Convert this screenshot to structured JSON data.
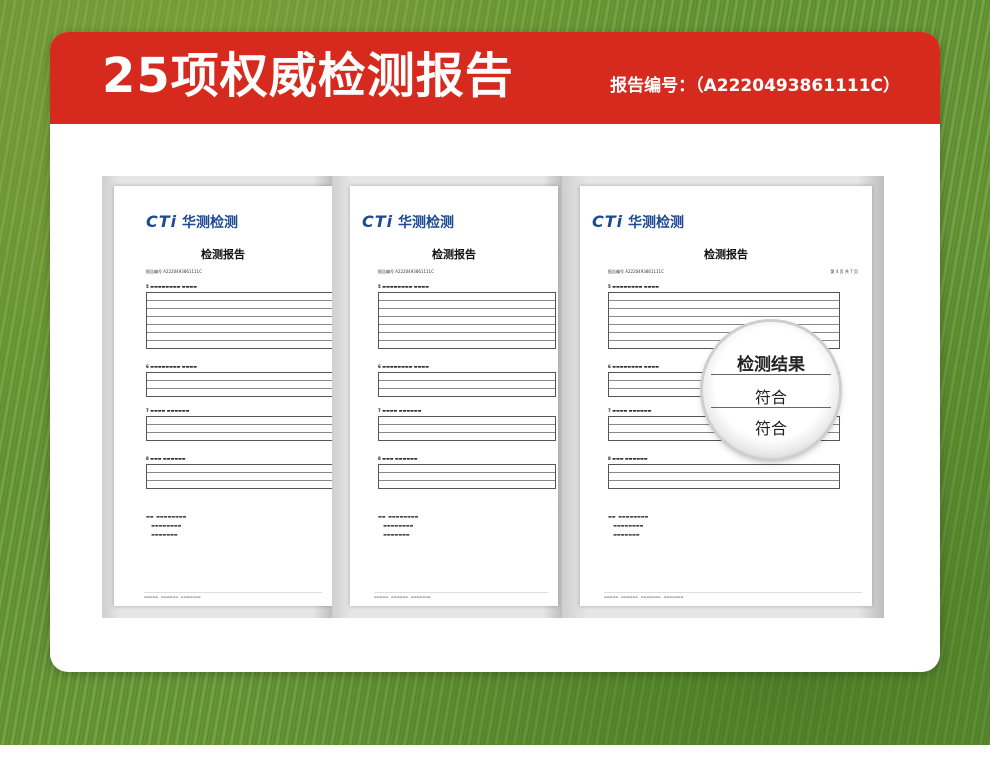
{
  "header": {
    "title": "25项权威检测报告",
    "report_number": "报告编号：（A2220493861111C）"
  },
  "colors": {
    "accent": "#d72a1f",
    "logo_blue": "#1f4a93"
  },
  "documents": [
    {
      "logo_text": "CTi",
      "logo_cn": "华测检测",
      "title": "检测报告",
      "report_no": "报告编号    A2220493861111C",
      "page": ""
    },
    {
      "logo_text": "CTi",
      "logo_cn": "华测检测",
      "title": "检测报告",
      "report_no": "报告编号    A2220493861111C",
      "page": ""
    },
    {
      "logo_text": "CTi",
      "logo_cn": "华测检测",
      "title": "检测报告",
      "report_no": "报告编号    A2220493861111C",
      "page": "第 4 页  共 7 页"
    }
  ],
  "magnifier": {
    "heading": "检测结果",
    "row1": "符合",
    "row2": "符合"
  }
}
